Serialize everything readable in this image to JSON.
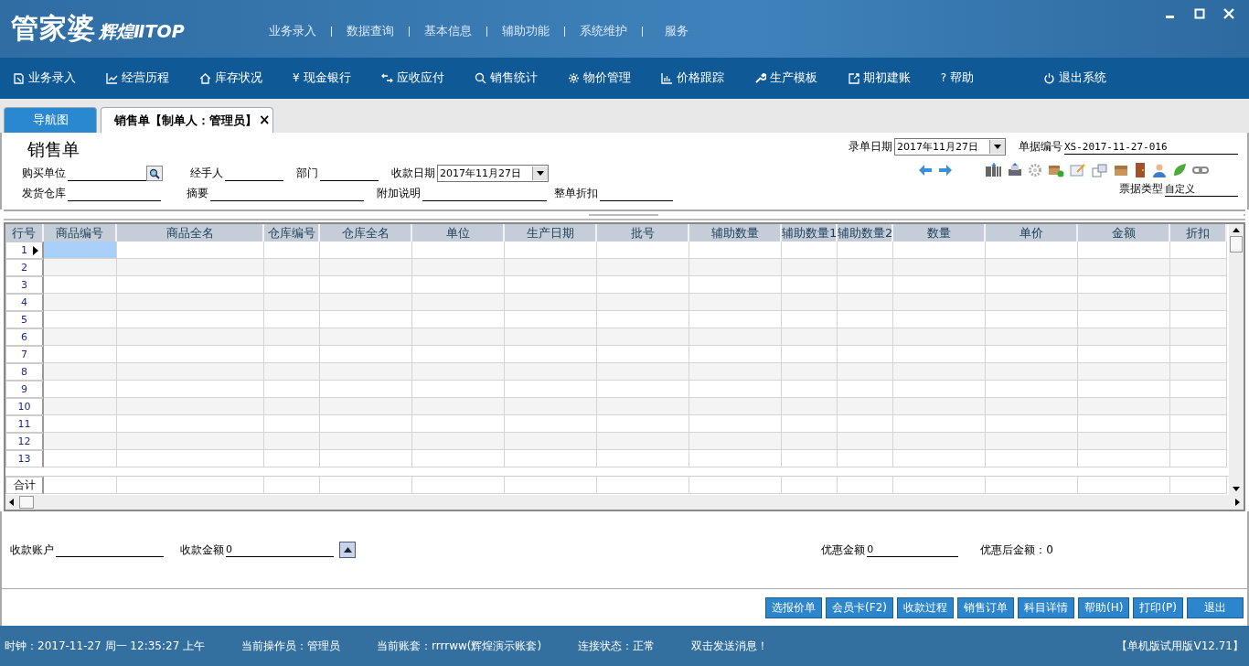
{
  "header": {
    "logo_main": "管家婆",
    "logo_sub": "辉煌ⅡTOP",
    "menu": [
      "业务录入",
      "数据查询",
      "基本信息",
      "辅助功能",
      "系统维护",
      "服务"
    ]
  },
  "toolbar": [
    {
      "label": "业务录入"
    },
    {
      "label": "经营历程"
    },
    {
      "label": "库存状况"
    },
    {
      "label": "现金银行",
      "glyph": "¥"
    },
    {
      "label": "应收应付"
    },
    {
      "label": "销售统计"
    },
    {
      "label": "物价管理"
    },
    {
      "label": "价格跟踪"
    },
    {
      "label": "生产模板"
    },
    {
      "label": "期初建账"
    },
    {
      "label": "帮助",
      "glyph": "?"
    },
    {
      "label": "退出系统"
    }
  ],
  "tabs": [
    {
      "label": "导航图",
      "selected": false
    },
    {
      "label": "销售单【制单人：管理员】",
      "selected": true,
      "close": "×"
    }
  ],
  "form": {
    "title": "销售单",
    "buyer": {
      "label": "购买单位"
    },
    "handler": {
      "label": "经手人"
    },
    "department": {
      "label": "部门"
    },
    "pay_date": {
      "label": "收款日期",
      "value": "2017年11月27日"
    },
    "warehouse": {
      "label": "发货仓库"
    },
    "summary": {
      "label": "摘要"
    },
    "note": {
      "label": "附加说明"
    },
    "discount": {
      "label": "整单折扣"
    },
    "entry_date": {
      "label": "录单日期",
      "value": "2017年11月27日"
    },
    "doc_no": {
      "label": "单据编号",
      "value": "XS-2017-11-27-016"
    },
    "doc_type": {
      "label": "票据类型",
      "value": "自定义"
    }
  },
  "grid": {
    "columns": [
      "行号",
      "商品编号",
      "商品全名",
      "仓库编号",
      "仓库全名",
      "单位",
      "生产日期",
      "批号",
      "辅助数量",
      "辅助数量1",
      "辅助数量2",
      "数量",
      "单价",
      "金额",
      "折扣"
    ],
    "rows": [
      {
        "no": "1",
        "selected": true
      },
      {
        "no": "2",
        "selected": false
      },
      {
        "no": "3",
        "selected": false
      },
      {
        "no": "4",
        "selected": false
      },
      {
        "no": "5",
        "selected": false
      },
      {
        "no": "6",
        "selected": false
      },
      {
        "no": "7",
        "selected": false
      },
      {
        "no": "8",
        "selected": false
      },
      {
        "no": "9",
        "selected": false
      },
      {
        "no": "10",
        "selected": false
      },
      {
        "no": "11",
        "selected": false
      },
      {
        "no": "12",
        "selected": false
      },
      {
        "no": "13",
        "selected": false
      }
    ],
    "total_label": "合计"
  },
  "payment": {
    "account": {
      "label": "收款账户"
    },
    "amount": {
      "label": "收款金额",
      "value": "0"
    },
    "discount": {
      "label": "优惠金额",
      "value": "0"
    },
    "after_discount": "优惠后金额：0"
  },
  "buttons": [
    "选报价单",
    "会员卡(F2)",
    "收款过程",
    "销售订单",
    "科目详情",
    "帮助(H)",
    "打印(P)",
    "退出"
  ],
  "status_bar": {
    "items": [
      "时钟：2017-11-27 周一 12:35:27 上午",
      "当前操作员：管理员",
      "当前账套：rrrrww(辉煌演示账套)",
      "连接状态：正常",
      "双击发送消息！"
    ],
    "version": "【单机版试用版V12.71】"
  }
}
